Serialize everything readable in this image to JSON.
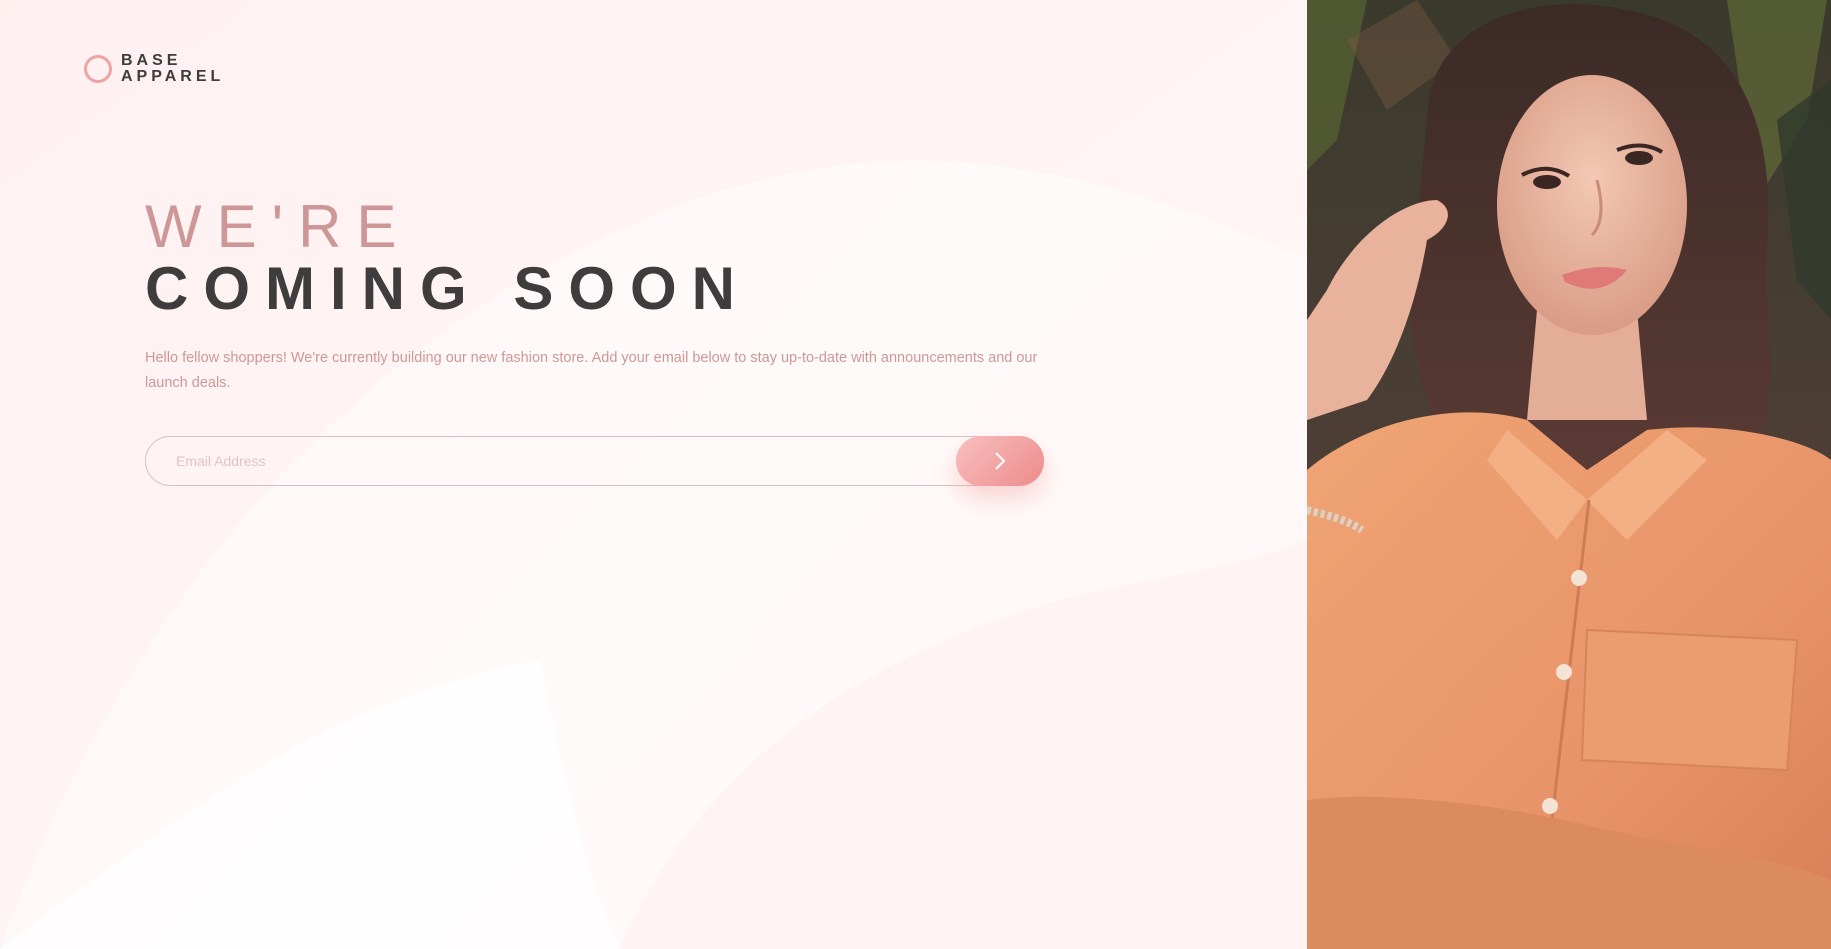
{
  "brand": {
    "line1": "BASE",
    "line2": "APPAREL",
    "accent_color": "#f0a3a3"
  },
  "hero": {
    "line1": "WE'RE",
    "line2": "COMING SOON",
    "line1_color": "#ce9797",
    "line2_color": "#3e3c3c"
  },
  "description": "Hello fellow shoppers! We're currently building our new fashion store. Add your email below to stay up-to-date with announcements and our launch deals.",
  "signup": {
    "email_placeholder": "Email Address",
    "email_value": "",
    "submit_icon": "chevron-right-icon",
    "button_gradient": [
      "#f8bfbf",
      "#ee8b8b"
    ]
  },
  "hero_image": {
    "subject": "woman-in-orange-shirt-photo"
  }
}
